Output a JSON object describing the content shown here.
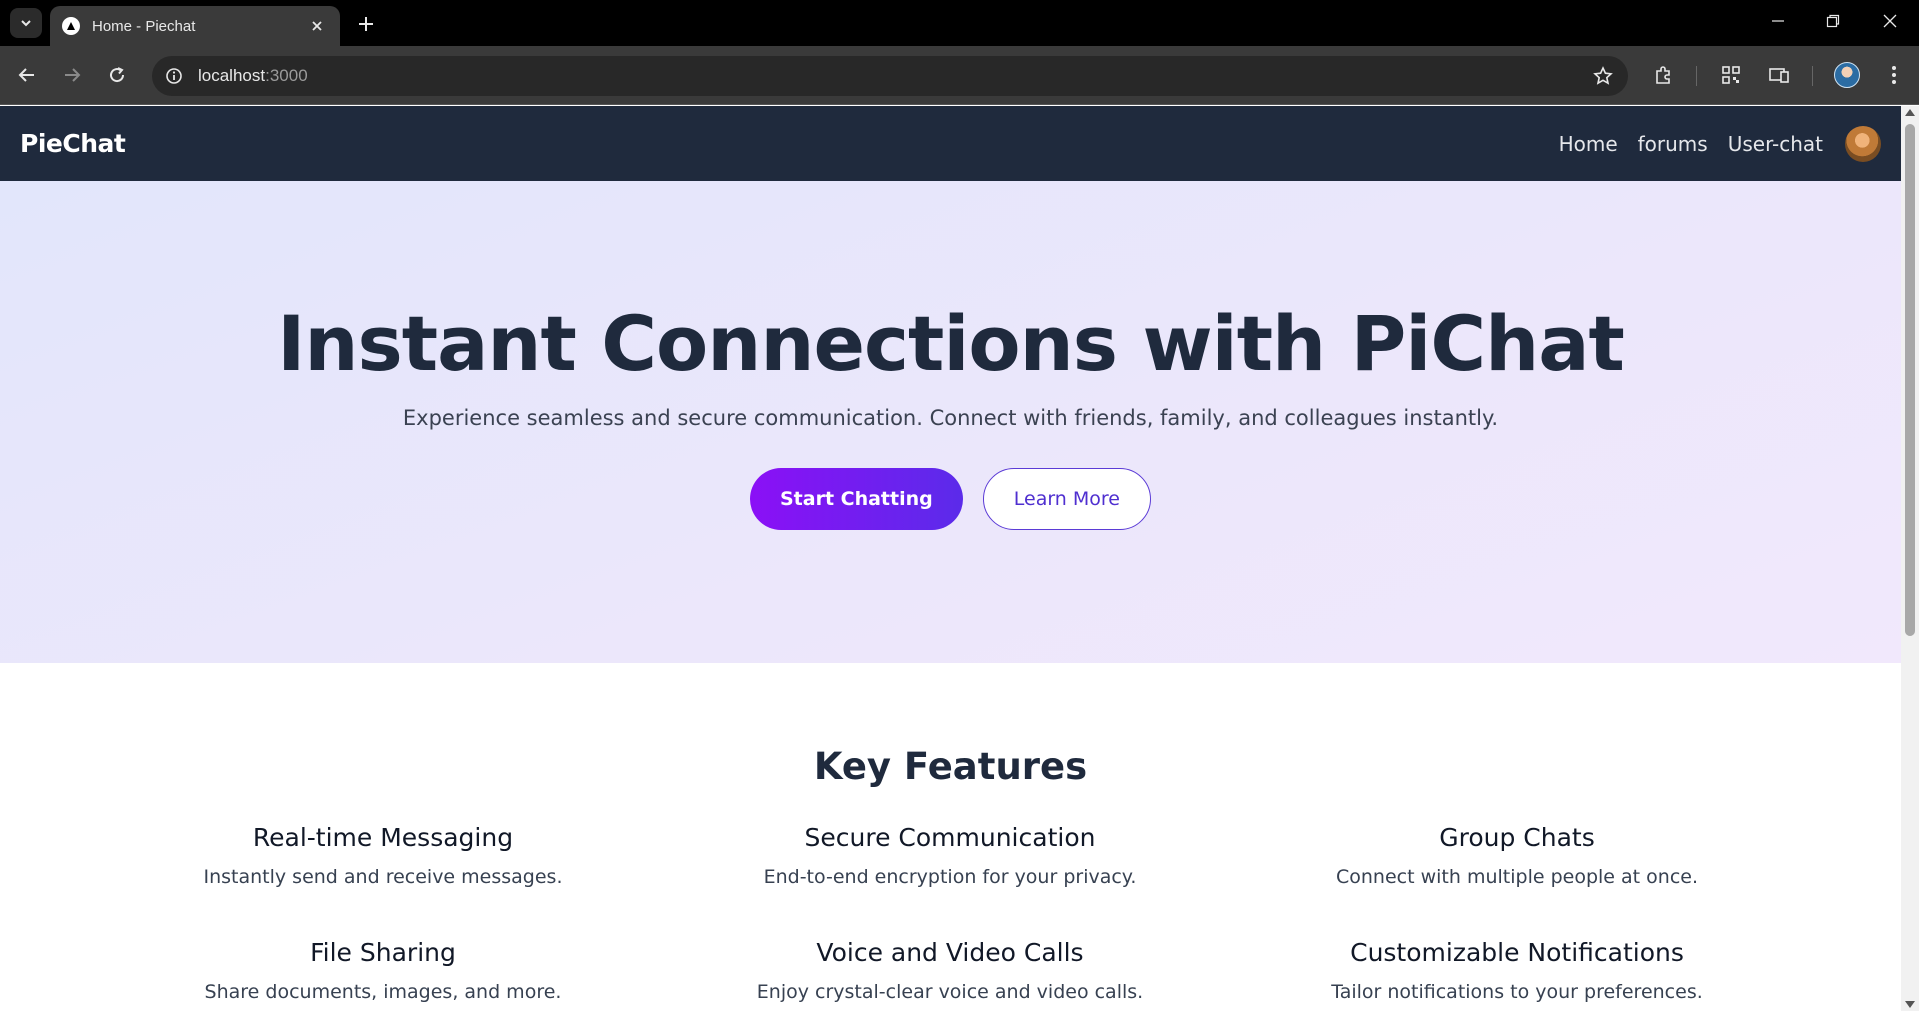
{
  "browser": {
    "tab_title": "Home - Piechat",
    "url_host": "localhost",
    "url_port": ":3000"
  },
  "nav": {
    "brand": "PieChat",
    "links": [
      "Home",
      "forums",
      "User-chat"
    ]
  },
  "hero": {
    "title": "Instant Connections with PiChat",
    "subtitle": "Experience seamless and secure communication. Connect with friends, family, and colleagues instantly.",
    "primary_button": "Start Chatting",
    "secondary_button": "Learn More"
  },
  "features": {
    "title": "Key Features",
    "items": [
      {
        "title": "Real-time Messaging",
        "desc": "Instantly send and receive messages."
      },
      {
        "title": "Secure Communication",
        "desc": "End-to-end encryption for your privacy."
      },
      {
        "title": "Group Chats",
        "desc": "Connect with multiple people at once."
      },
      {
        "title": "File Sharing",
        "desc": "Share documents, images, and more."
      },
      {
        "title": "Voice and Video Calls",
        "desc": "Enjoy crystal-clear voice and video calls."
      },
      {
        "title": "Customizable Notifications",
        "desc": "Tailor notifications to your preferences."
      }
    ]
  },
  "colors": {
    "navbar": "#1f2a3d",
    "accent_start": "#8b10f6",
    "accent_end": "#5b2bea",
    "hero_bg": "#e6e8fb"
  }
}
